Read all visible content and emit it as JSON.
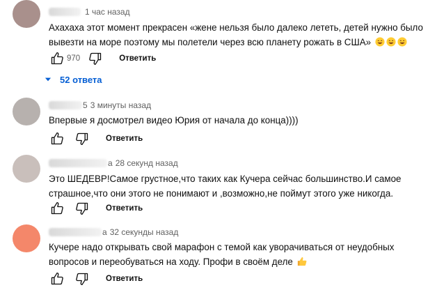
{
  "comments": [
    {
      "name_tail": "",
      "time": "1 час назад",
      "text_lines": [
        "Ахахаха этот момент прекрасен «жене нельзя было далеко лететь, детей нужно было",
        "вывезти на море поэтому мы полетели через всю планету рожать в США»"
      ],
      "likes": "970",
      "reply_label": "Ответить",
      "replies_label": "52 ответа",
      "emoji_count": 3
    },
    {
      "name_tail": "5",
      "time": "3 минуты назад",
      "text_lines": [
        "Впервые я досмотрел видео Юрия от начала до конца))))"
      ],
      "likes": "",
      "reply_label": "Ответить"
    },
    {
      "name_tail": "а",
      "time": "28 секунд назад",
      "text_lines": [
        "Это ШЕДЕВР!Самое грустное,что таких как Кучера сейчас большинство.И самое",
        "страшное,что они этого не понимают и ,возможно,не поймут этого уже никогда."
      ],
      "likes": "",
      "reply_label": "Ответить"
    },
    {
      "name_tail": "а",
      "time": "32 секунды назад",
      "text_lines": [
        "Кучере надо открывать свой марафон с темой как уворачиваться от неудобных",
        "вопросов и переобуваться на ходу. Профи в своём деле"
      ],
      "likes": "",
      "reply_label": "Ответить"
    }
  ],
  "colors": {
    "avatar_1": "#a9908c",
    "avatar_2": "#b7b1ae",
    "avatar_3": "#c9bfbb",
    "avatar_4": "#f4876a",
    "link_blue": "#065fd4"
  },
  "icons": {
    "like": "thumb-up-icon",
    "dislike": "thumb-down-icon",
    "expand": "chevron-down-icon",
    "emoji_laugh": "grinning-face-icon",
    "emoji_thumb": "thumbs-up-emoji-icon"
  }
}
